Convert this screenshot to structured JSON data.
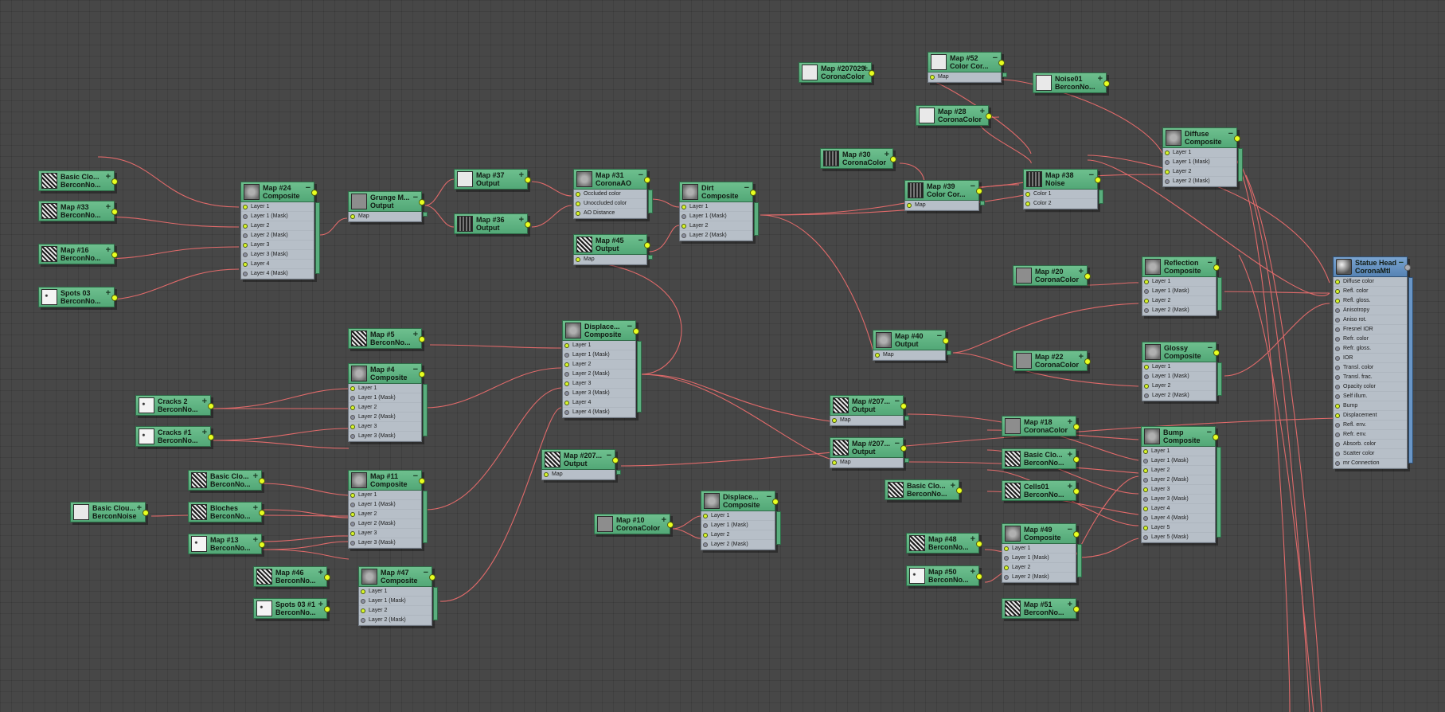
{
  "nodes": [
    {
      "title": "Basic Clo...",
      "type": "BerconNo...",
      "thumb": "noise"
    },
    {
      "title": "Map #33",
      "type": "BerconNo...",
      "thumb": "noise"
    },
    {
      "title": "Map #16",
      "type": "BerconNo...",
      "thumb": "noise"
    },
    {
      "title": "Spots 03",
      "type": "BerconNo...",
      "thumb": "spots"
    },
    {
      "title": "Map #24",
      "type": "Composite",
      "thumb": "comp",
      "rows": [
        "Layer 1",
        "Layer 1 (Mask)",
        "Layer 2",
        "Layer 2 (Mask)",
        "Layer 3",
        "Layer 3 (Mask)",
        "Layer 4",
        "Layer 4 (Mask)"
      ]
    },
    {
      "title": "Grunge M...",
      "type": "Output",
      "thumb": "grey",
      "rows": [
        "Map"
      ]
    },
    {
      "title": "Map #37",
      "type": "Output",
      "thumb": "light"
    },
    {
      "title": "Map #36",
      "type": "Output",
      "thumb": "dark"
    },
    {
      "title": "Map #31",
      "type": "CoronaAO",
      "thumb": "comp",
      "rows": [
        "Occluded color",
        "Unoccluded color",
        "AO Distance"
      ]
    },
    {
      "title": "Map #45",
      "type": "Output",
      "thumb": "noise",
      "rows": [
        "Map"
      ]
    },
    {
      "title": "Dirt",
      "type": "Composite",
      "thumb": "comp",
      "rows": [
        "Layer 1",
        "Layer 1 (Mask)",
        "Layer 2",
        "Layer 2 (Mask)"
      ]
    },
    {
      "title": "Map #207029...",
      "type": "CoronaColor",
      "thumb": "light"
    },
    {
      "title": "Map #52",
      "type": "Color Cor...",
      "thumb": "light",
      "rows": [
        "Map"
      ]
    },
    {
      "title": "Map #28",
      "type": "CoronaColor",
      "thumb": "light"
    },
    {
      "title": "Noise01",
      "type": "BerconNo...",
      "thumb": "light"
    },
    {
      "title": "Map #30",
      "type": "CoronaColor",
      "thumb": "dark"
    },
    {
      "title": "Map #39",
      "type": "Color Cor...",
      "thumb": "dark",
      "rows": [
        "Map"
      ]
    },
    {
      "title": "Map #38",
      "type": "Noise",
      "thumb": "dark",
      "rows": [
        "Color 1",
        "Color 2"
      ]
    },
    {
      "title": "Diffuse",
      "type": "Composite",
      "thumb": "comp",
      "rows": [
        "Layer 1",
        "Layer 1 (Mask)",
        "Layer 2",
        "Layer 2 (Mask)"
      ]
    },
    {
      "title": "Map #20",
      "type": "CoronaColor",
      "thumb": "grey"
    },
    {
      "title": "Reflection",
      "type": "Composite",
      "thumb": "comp",
      "rows": [
        "Layer 1",
        "Layer 1 (Mask)",
        "Layer 2",
        "Layer 2 (Mask)"
      ]
    },
    {
      "title": "Map #40",
      "type": "Output",
      "thumb": "comp",
      "rows": [
        "Map"
      ]
    },
    {
      "title": "Map #22",
      "type": "CoronaColor",
      "thumb": "grey"
    },
    {
      "title": "Glossy",
      "type": "Composite",
      "thumb": "comp",
      "rows": [
        "Layer 1",
        "Layer 1 (Mask)",
        "Layer 2",
        "Layer 2 (Mask)"
      ]
    },
    {
      "title": "Statue Head",
      "type": "CoronaMtl",
      "thumb": "mat",
      "mat": true,
      "rows": [
        "Diffuse color",
        "Refl. color",
        "Refl. gloss.",
        "Anisotropy",
        "Aniso rot.",
        "Fresnel IOR",
        "Refr. color",
        "Refr. gloss.",
        "IOR",
        "Transl. color",
        "Transl. frac.",
        "Opacity color",
        "Self illum.",
        "Bump",
        "Displacement",
        "Refl. env.",
        "Refr. env.",
        "Absorb. color",
        "Scatter color",
        "mr Connection"
      ]
    },
    {
      "title": "Map #5",
      "type": "BerconNo...",
      "thumb": "noise"
    },
    {
      "title": "Map #4",
      "type": "Composite",
      "thumb": "comp",
      "rows": [
        "Layer 1",
        "Layer 1 (Mask)",
        "Layer 2",
        "Layer 2 (Mask)",
        "Layer 3",
        "Layer 3 (Mask)"
      ]
    },
    {
      "title": "Displace...",
      "type": "Composite",
      "thumb": "comp",
      "rows": [
        "Layer 1",
        "Layer 1 (Mask)",
        "Layer 2",
        "Layer 2 (Mask)",
        "Layer 3",
        "Layer 3 (Mask)",
        "Layer 4",
        "Layer 4 (Mask)"
      ]
    },
    {
      "title": "Cracks 2",
      "type": "BerconNo...",
      "thumb": "spots"
    },
    {
      "title": "Cracks #1",
      "type": "BerconNo...",
      "thumb": "spots"
    },
    {
      "title": "Map #207...",
      "type": "Output",
      "thumb": "noise",
      "rows": [
        "Map"
      ]
    },
    {
      "title": "Map #207...",
      "type": "Output",
      "thumb": "noise",
      "rows": [
        "Map"
      ]
    },
    {
      "title": "Map #18",
      "type": "CoronaColor",
      "thumb": "grey"
    },
    {
      "title": "Basic Clo...",
      "type": "BerconNo...",
      "thumb": "noise"
    },
    {
      "title": "Basic Clo...",
      "type": "BerconNo...",
      "thumb": "noise"
    },
    {
      "title": "Cells01",
      "type": "BerconNo...",
      "thumb": "noise"
    },
    {
      "title": "Bump",
      "type": "Composite",
      "thumb": "comp",
      "rows": [
        "Layer 1",
        "Layer 1 (Mask)",
        "Layer 2",
        "Layer 2 (Mask)",
        "Layer 3",
        "Layer 3 (Mask)",
        "Layer 4",
        "Layer 4 (Mask)",
        "Layer 5",
        "Layer 5 (Mask)"
      ]
    },
    {
      "title": "Map #207...",
      "type": "Output",
      "thumb": "noise",
      "rows": [
        "Map"
      ]
    },
    {
      "title": "Basic Clo...",
      "type": "BerconNo...",
      "thumb": "noise"
    },
    {
      "title": "Basic Clou...",
      "type": "BerconNoise",
      "thumb": "light"
    },
    {
      "title": "Bloches",
      "type": "BerconNo...",
      "thumb": "noise"
    },
    {
      "title": "Map #13",
      "type": "BerconNo...",
      "thumb": "spots"
    },
    {
      "title": "Map #11",
      "type": "Composite",
      "thumb": "comp",
      "rows": [
        "Layer 1",
        "Layer 1 (Mask)",
        "Layer 2",
        "Layer 2 (Mask)",
        "Layer 3",
        "Layer 3 (Mask)"
      ]
    },
    {
      "title": "Map #10",
      "type": "CoronaColor",
      "thumb": "grey"
    },
    {
      "title": "Displace...",
      "type": "Composite",
      "thumb": "comp",
      "rows": [
        "Layer 1",
        "Layer 1 (Mask)",
        "Layer 2",
        "Layer 2 (Mask)"
      ]
    },
    {
      "title": "Map #48",
      "type": "BerconNo...",
      "thumb": "noise"
    },
    {
      "title": "Map #49",
      "type": "Composite",
      "thumb": "comp",
      "rows": [
        "Layer 1",
        "Layer 1 (Mask)",
        "Layer 2",
        "Layer 2 (Mask)"
      ]
    },
    {
      "title": "Map #50",
      "type": "BerconNo...",
      "thumb": "spots"
    },
    {
      "title": "Map #51",
      "type": "BerconNo...",
      "thumb": "noise"
    },
    {
      "title": "Map #46",
      "type": "BerconNo...",
      "thumb": "noise"
    },
    {
      "title": "Map #47",
      "type": "Composite",
      "thumb": "comp",
      "rows": [
        "Layer 1",
        "Layer 1 (Mask)",
        "Layer 2",
        "Layer 2 (Mask)"
      ]
    },
    {
      "title": "Spots 03 #1",
      "type": "BerconNo...",
      "thumb": "spots"
    }
  ]
}
